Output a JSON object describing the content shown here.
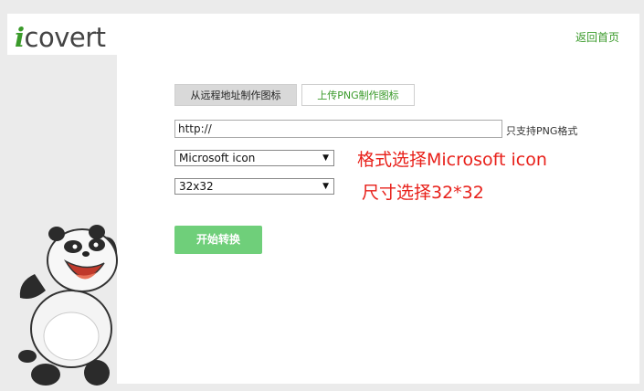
{
  "header": {
    "logo_i": "i",
    "logo_text": "covert",
    "home_link": "返回首页"
  },
  "tabs": {
    "remote": "从远程地址制作图标",
    "upload": "上传PNG制作图标"
  },
  "form": {
    "url_value": "http://",
    "url_hint": "只支持PNG格式",
    "format_selected": "Microsoft icon",
    "size_selected": "32x32",
    "convert_button": "开始转换"
  },
  "annotations": {
    "format_note": "格式选择Microsoft icon",
    "size_note": "尺寸选择32*32"
  },
  "colors": {
    "brand_green": "#3a9a2a",
    "button_green": "#6fcf7a",
    "note_red": "#e8201a"
  }
}
